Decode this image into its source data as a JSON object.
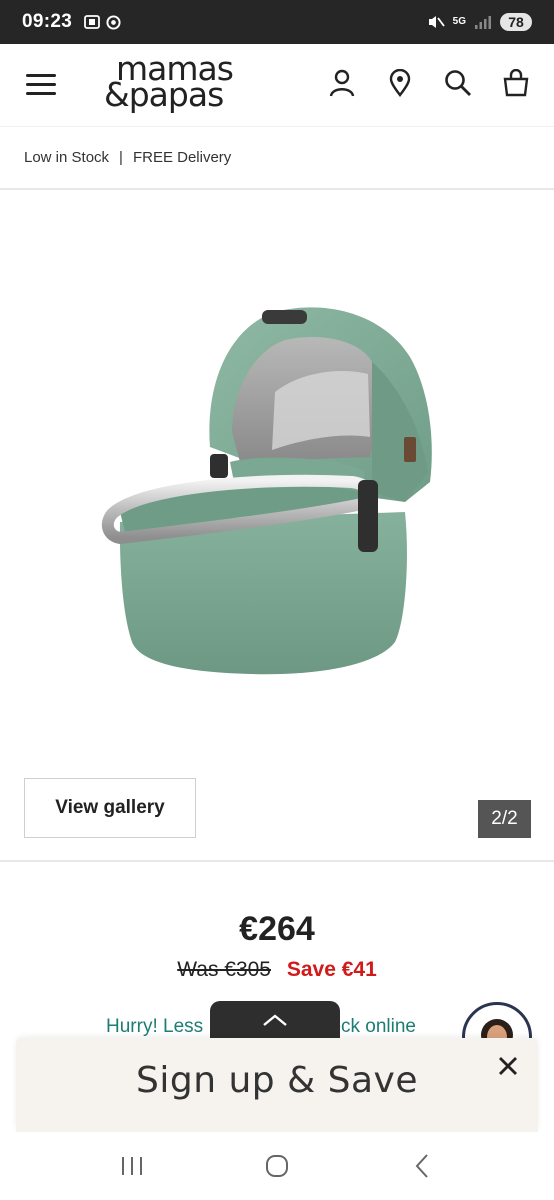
{
  "status_bar": {
    "time": "09:23",
    "battery": "78",
    "network": "5G"
  },
  "header": {
    "logo_line1": "mamas",
    "logo_line2": "&papas",
    "icons": [
      "menu-icon",
      "account-icon",
      "store-locator-icon",
      "search-icon",
      "basket-icon"
    ]
  },
  "stock": {
    "availability": "Low in Stock",
    "separator": "|",
    "delivery": "FREE Delivery"
  },
  "gallery": {
    "view_label": "View gallery",
    "pager": "2/2"
  },
  "pricing": {
    "price": "€264",
    "was": "Was €305",
    "save": "Save €41"
  },
  "hurry": {
    "left": "Hurry! Less",
    "right": "tock online"
  },
  "signup": {
    "text": "Sign up & Save"
  },
  "colors": {
    "status_bar": "#262626",
    "save_red": "#d11a1a",
    "hurry_teal": "#1d7d74",
    "carrycot_green": "#7aa892",
    "banner_bg": "#f6f3ee"
  }
}
